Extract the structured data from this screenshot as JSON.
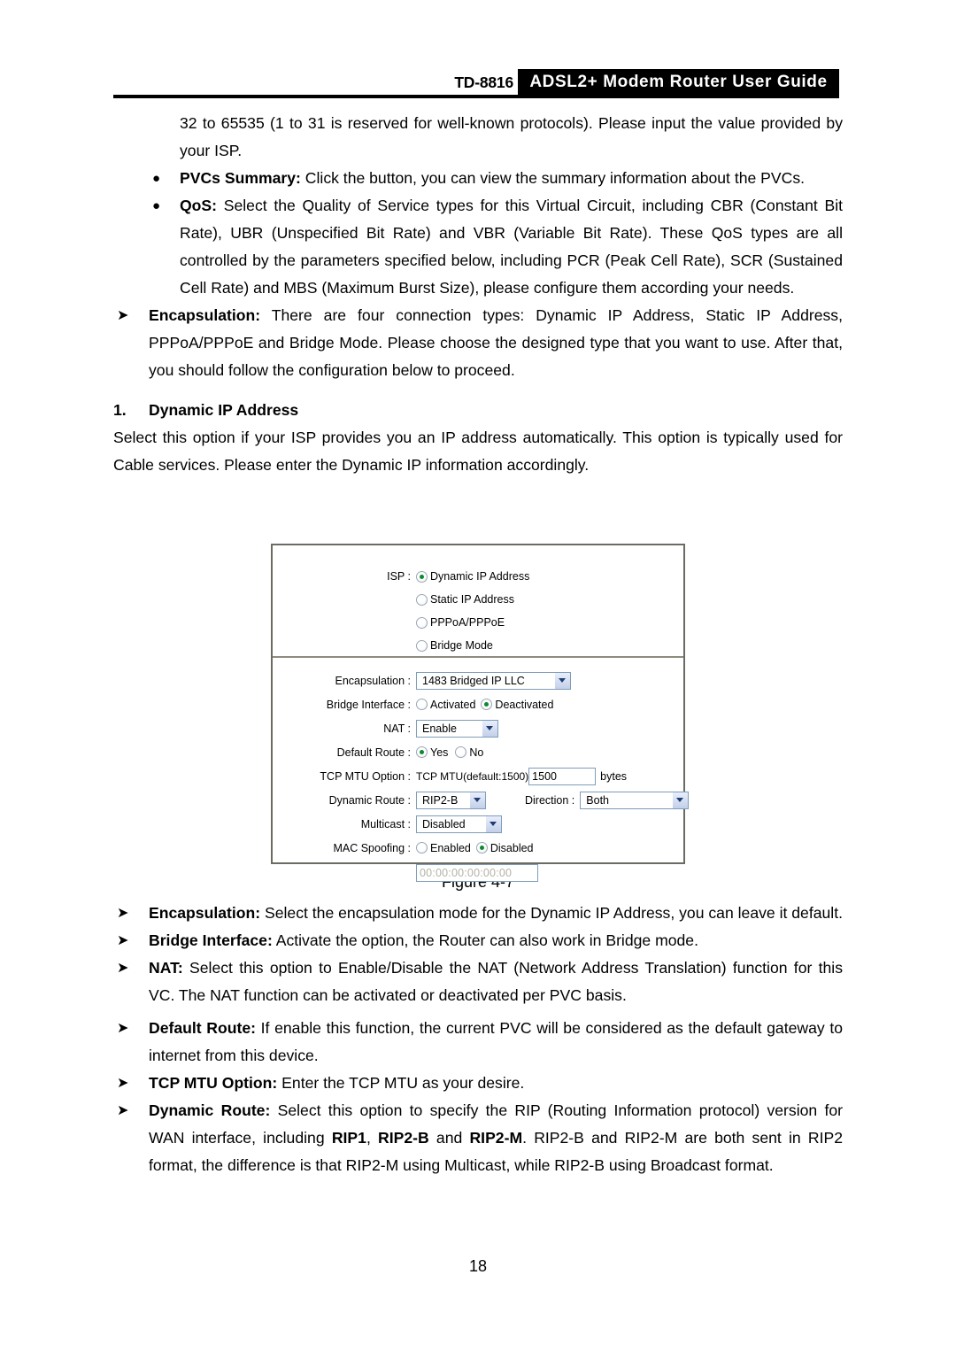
{
  "header": {
    "model": "TD-8816",
    "title": "ADSL2+ Modem Router User Guide"
  },
  "body": {
    "para_intro": "32 to 65535 (1 to 31 is reserved for well-known protocols). Please input the value provided by your ISP.",
    "bullet_pvcs_term": "PVCs Summary:",
    "bullet_pvcs_text": " Click the button, you can view the summary information about the PVCs.",
    "bullet_qos_term": "QoS:",
    "bullet_qos_text": " Select the Quality of Service types for this Virtual Circuit, including CBR (Constant Bit Rate), UBR (Unspecified Bit Rate) and VBR (Variable Bit Rate). These QoS types are all controlled by the parameters specified below, including PCR (Peak Cell Rate), SCR (Sustained Cell Rate) and MBS (Maximum Burst Size), please configure them according your needs.",
    "bullet_encap_term": "Encapsulation:",
    "bullet_encap_text": " There are four connection types: Dynamic IP Address, Static IP Address, PPPoA/PPPoE and Bridge Mode. Please choose the designed type that you want to use. After that, you should follow the configuration below to proceed.",
    "numbered_heading_num": "1.",
    "numbered_heading_text": "Dynamic IP Address",
    "para_dynamic": "Select this option if your ISP provides you an IP address automatically. This option is typically used for Cable services. Please enter the Dynamic IP information accordingly.",
    "bullet2_encap_term": "Encapsulation:",
    "bullet2_encap_text": " Select the encapsulation mode for the Dynamic IP Address, you can leave it default.",
    "bullet2_bridge_term": "Bridge Interface:",
    "bullet2_bridge_text": " Activate the option, the Router can also work in Bridge mode.",
    "bullet2_nat_term": "NAT:",
    "bullet2_nat_text": " Select this option to Enable/Disable the NAT (Network Address Translation) function for this VC. The NAT function can be activated or deactivated per PVC basis.",
    "bullet2_defroute_term": "Default Route:",
    "bullet2_defroute_text": " If enable this function, the current PVC will be considered as the default gateway to internet from this device.",
    "bullet2_mtu_term": "TCP MTU Option:",
    "bullet2_mtu_text": " Enter the TCP MTU as your desire.",
    "bullet2_dynroute_term": "Dynamic Route:",
    "bullet2_dynroute_text_1": " Select this option to specify the RIP (Routing Information protocol) version for WAN interface, including ",
    "bullet2_dynroute_rip1": "RIP1",
    "bullet2_dynroute_sep1": ", ",
    "bullet2_dynroute_rip2b": "RIP2-B",
    "bullet2_dynroute_sep2": " and ",
    "bullet2_dynroute_rip2m": "RIP2-M",
    "bullet2_dynroute_text_2": ". RIP2-B and RIP2-M are both sent in RIP2 format, the difference is that RIP2-M using Multicast, while RIP2-B using Broadcast format."
  },
  "figure": {
    "caption": "Figure 4-7",
    "isp": {
      "label": "ISP :",
      "options": [
        {
          "label": "Dynamic IP Address",
          "selected": true
        },
        {
          "label": "Static IP Address",
          "selected": false
        },
        {
          "label": "PPPoA/PPPoE",
          "selected": false
        },
        {
          "label": "Bridge Mode",
          "selected": false
        }
      ]
    },
    "form": {
      "encapsulation_label": "Encapsulation :",
      "encapsulation_value": "1483 Bridged IP LLC",
      "bridge_interface_label": "Bridge Interface :",
      "bridge_activated_label": "Activated",
      "bridge_deactivated_label": "Deactivated",
      "bridge_selected": "Deactivated",
      "nat_label": "NAT :",
      "nat_value": "Enable",
      "default_route_label": "Default Route :",
      "default_route_yes": "Yes",
      "default_route_no": "No",
      "default_route_selected": "Yes",
      "tcp_mtu_label": "TCP MTU Option :",
      "tcp_mtu_hint": "TCP MTU(default:1500)",
      "tcp_mtu_value": "1500",
      "tcp_mtu_unit": "bytes",
      "dynamic_route_label": "Dynamic Route :",
      "dynamic_route_value": "RIP2-B",
      "direction_label": "Direction :",
      "direction_value": "Both",
      "multicast_label": "Multicast :",
      "multicast_value": "Disabled",
      "mac_spoofing_label": "MAC Spoofing :",
      "mac_enabled_label": "Enabled",
      "mac_disabled_label": "Disabled",
      "mac_selected": "Disabled",
      "mac_address_value": "00:00:00:00:00:00"
    }
  },
  "footer": {
    "page_number": "18"
  }
}
